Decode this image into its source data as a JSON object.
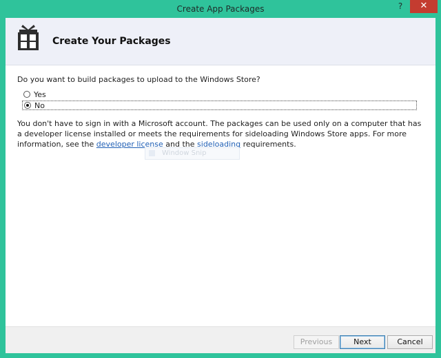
{
  "window": {
    "title": "Create App Packages",
    "help_glyph": "?",
    "close_glyph": "✕",
    "frame_color": "#2fc39b",
    "close_color": "#c43c30"
  },
  "header": {
    "title": "Create Your Packages",
    "icon": "gift-box-icon"
  },
  "question": "Do you want to build packages to upload to the Windows Store?",
  "options": [
    {
      "label": "Yes",
      "checked": false
    },
    {
      "label": "No",
      "checked": true
    }
  ],
  "info": {
    "text_before": "You don't have to sign in with a Microsoft account. The packages can be used only on a computer that has a developer license installed or meets the requirements for sideloading Windows Store apps. For more information, see the ",
    "link1": "developer license",
    "text_mid": " and the ",
    "link2": "sideloading",
    "text_after": " requirements.",
    "link_color": "#1f5fb5"
  },
  "ghost_overlay": {
    "label": "Window Snip"
  },
  "footer": {
    "previous_label": "Previous",
    "next_label": "Next",
    "cancel_label": "Cancel"
  }
}
